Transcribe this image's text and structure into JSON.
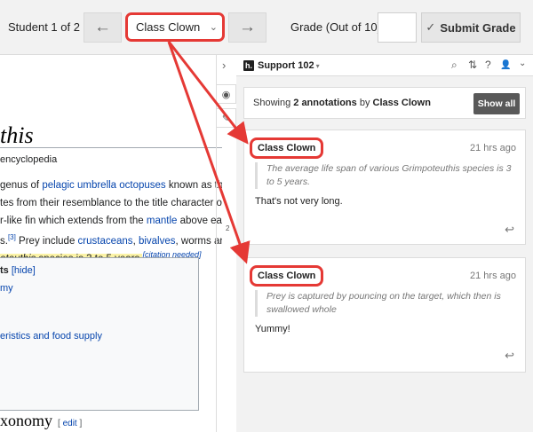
{
  "toolbar": {
    "student_label": "Student 1 of 2",
    "prev_icon": "←",
    "next_icon": "→",
    "selected_student": "Class Clown",
    "chevron": "⌄",
    "grade_label": "Grade (Out of 10)",
    "grade_value": "",
    "submit_check": "✓",
    "submit_label": "Submit Grade"
  },
  "article": {
    "title": "this",
    "tagline": "encyclopedia",
    "line1_pre": "genus of ",
    "line1_link": "pelagic umbrella octopuses",
    "line1_post": " known as the d",
    "line2": "tes from their resemblance to the title character of Dis",
    "line3_pre": "r-like fin which extends from the ",
    "line3_link": "mantle",
    "line3_post": " above each e",
    "line4_pre": "s.",
    "line4_sup": "[3]",
    "line4_mid": " Prey include ",
    "line4_link1": "crustaceans",
    "line4_sep": ", ",
    "line4_link2": "bivalves",
    "line4_post": ", worms and",
    "line5_hl_italic": "oteuthis",
    "line5_hl": " species is 3 to 5 years.",
    "line5_cite": "[citation needed]",
    "toc_head": "ts",
    "toc_hide": "[hide]",
    "toc_item1": "my",
    "toc_item2": "eristics and food supply",
    "section_title": "xonomy",
    "section_edit_open": "[ ",
    "section_edit": "edit",
    "section_edit_close": " ]"
  },
  "sidebar": {
    "collapse_icon": "›",
    "eye_icon": "◉",
    "note_icon": "✎",
    "count": "2"
  },
  "panel": {
    "logo": "h.",
    "group_name": "Support 102",
    "group_caret": "▾",
    "search_icon": "⌕",
    "sort_icon": "⇅",
    "help_icon": "?",
    "user_icon": "👤",
    "user_caret": "⌄",
    "summary_pre": "Showing ",
    "summary_count": "2 annotations",
    "summary_mid": " by ",
    "summary_user": "Class Clown",
    "show_all": "Show all"
  },
  "annotations": [
    {
      "user": "Class Clown",
      "time": "21 hrs ago",
      "quote": "The average life span of various Grimpoteuthis species is 3 to 5 years.",
      "body": "That's not very long.",
      "reply_icon": "↩"
    },
    {
      "user": "Class Clown",
      "time": "21 hrs ago",
      "quote": "Prey is captured by pouncing on the target, which then is swallowed whole",
      "body": "Yummy!",
      "reply_icon": "↩"
    }
  ],
  "colors": {
    "highlight_red": "#e53935",
    "link_blue": "#0645ad",
    "highlight_yellow": "#fbf3a6"
  }
}
